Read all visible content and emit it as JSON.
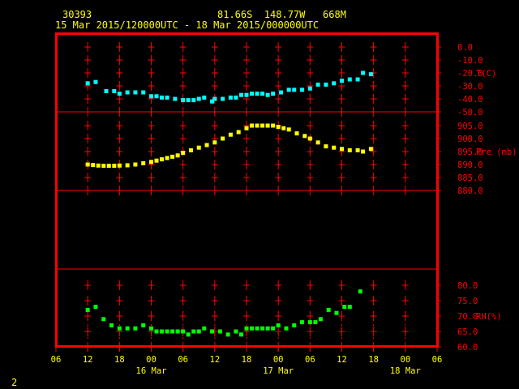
{
  "header": {
    "station": "30393",
    "location": "81.66S  148.77W   668M",
    "time_range": "15 Mar 2015/120000UTC - 18 Mar 2015/000000UTC"
  },
  "corner_label": "2",
  "colors": {
    "frame": "#ff0000",
    "grid": "#ff0000",
    "labels": "#ffff00",
    "temperature": "#00ffff",
    "pressure": "#ffff00",
    "humidity": "#00ff00"
  },
  "chart_data": {
    "type": "scatter",
    "x_unit": "hours since 15 Mar 06 UTC",
    "x_range": [
      0,
      72
    ],
    "x_ticks": [
      "06",
      "12",
      "18",
      "00",
      "06",
      "12",
      "18",
      "00",
      "06",
      "12",
      "18",
      "00",
      "06"
    ],
    "day_labels": [
      {
        "text": "16 Mar",
        "x": 18
      },
      {
        "text": "17 Mar",
        "x": 42
      },
      {
        "text": "18 Mar",
        "x": 66
      }
    ],
    "panels": [
      {
        "name": "temperature",
        "ylabel": "T(C)",
        "ylim": [
          -50,
          5
        ],
        "y_ticks": [
          "0.0",
          "-10.0",
          "-20.0",
          "-30.0",
          "-40.0",
          "-50.0"
        ],
        "tick_values": [
          0,
          -10,
          -20,
          -30,
          -40,
          -50
        ],
        "series": [
          {
            "x": [
              6,
              7.5,
              9.5,
              11,
              12,
              13.5,
              15,
              16.5,
              18,
              19,
              20,
              21,
              22.5,
              24,
              25,
              26,
              27,
              28,
              29.5,
              30,
              31.5,
              33,
              34,
              35,
              36,
              37,
              38,
              39,
              40,
              41,
              42.5,
              44,
              45,
              46.5,
              48,
              49.5,
              51,
              52.5,
              54,
              55.5,
              57,
              58,
              59.5
            ],
            "y": [
              -28,
              -27,
              -34,
              -34,
              -36,
              -35,
              -35,
              -35,
              -38,
              -38,
              -39,
              -39,
              -40,
              -41,
              -41,
              -41,
              -40,
              -39,
              -42,
              -40,
              -40,
              -39,
              -39,
              -37,
              -37,
              -36,
              -36,
              -36,
              -37,
              -36,
              -35,
              -33,
              -33,
              -33,
              -32,
              -29,
              -29,
              -28,
              -26,
              -25,
              -25,
              -20,
              -21
            ]
          }
        ]
      },
      {
        "name": "pressure",
        "ylabel": "Pre (mb)",
        "ylim": [
          880,
          910
        ],
        "y_ticks": [
          "905.0",
          "900.0",
          "895.0",
          "890.0",
          "885.0",
          "880.0"
        ],
        "tick_values": [
          905,
          900,
          895,
          890,
          885,
          880
        ],
        "series": [
          {
            "x": [
              6,
              7,
              8,
              9,
              10,
              11,
              12,
              13.5,
              15,
              16.5,
              18,
              19,
              20,
              21,
              22,
              23,
              24,
              25.5,
              27,
              28.5,
              30,
              31.5,
              33,
              34.5,
              36,
              37,
              38,
              39,
              40,
              41,
              42,
              43,
              44,
              45.5,
              47,
              48,
              49.5,
              51,
              52.5,
              54,
              55.5,
              57,
              58,
              59.5
            ],
            "y": [
              890,
              889.8,
              889.6,
              889.5,
              889.5,
              889.5,
              889.6,
              889.7,
              890,
              890.5,
              891,
              891.5,
              892,
              892.5,
              893,
              893.5,
              894.5,
              895.5,
              896.5,
              897.5,
              898.5,
              900,
              901.5,
              902.5,
              904,
              905,
              905,
              905,
              905,
              905,
              904.5,
              904,
              903.5,
              902,
              901,
              900,
              898.5,
              897,
              896.5,
              896,
              895.5,
              895.5,
              895,
              896
            ]
          }
        ]
      },
      {
        "name": "humidity",
        "ylabel": "RH(%)",
        "ylim": [
          60,
          80
        ],
        "y_ticks": [
          "80.0",
          "75.0",
          "70.0",
          "65.0",
          "60.0"
        ],
        "tick_values": [
          80,
          75,
          70,
          65,
          60
        ],
        "series": [
          {
            "x": [
              6,
              7.5,
              9,
              10.5,
              12,
              13.5,
              15,
              16.5,
              18,
              19,
              20,
              21,
              22,
              23,
              24,
              25,
              26,
              27,
              28,
              29.5,
              31,
              32.5,
              34,
              35,
              36,
              37,
              38,
              39,
              40,
              41,
              42,
              43.5,
              45,
              46.5,
              48,
              49,
              50,
              51.5,
              53,
              54.5,
              55.5,
              57.5
            ],
            "y": [
              72,
              73,
              69,
              67,
              66,
              66,
              66,
              67,
              66,
              65,
              65,
              65,
              65,
              65,
              65,
              64,
              65,
              65,
              66,
              65,
              65,
              64,
              65,
              64,
              66,
              66,
              66,
              66,
              66,
              66,
              67,
              66,
              67,
              68,
              68,
              68,
              69,
              72,
              71,
              73,
              73,
              78
            ]
          }
        ]
      }
    ]
  }
}
